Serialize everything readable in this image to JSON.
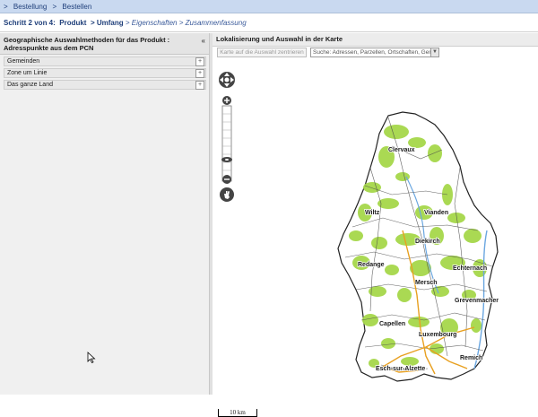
{
  "breadcrumb": {
    "items": [
      ">",
      "Bestellung",
      ">",
      "Bestellen"
    ]
  },
  "steps": {
    "prefix": "Schritt 2 von 4:",
    "step1": "Produkt",
    "sep1": ">",
    "step2": "Umfang",
    "sep2": ">",
    "step3": "Eigenschaften",
    "sep3": ">",
    "step4": "Zusammenfassung"
  },
  "left_panel": {
    "title": "Geographische Auswahlmethoden für das Produkt : Adresspunkte aus dem PCN",
    "collapse_label": "«",
    "items": [
      {
        "label": "Gemeinden",
        "toggle": "+"
      },
      {
        "label": "Zone um Linie",
        "toggle": "+"
      },
      {
        "label": "Das ganze Land",
        "toggle": "+"
      }
    ]
  },
  "map_panel": {
    "title": "Lokalisierung und Auswahl in der Karte",
    "center_button": "Karte auf die Auswahl zentrieren",
    "search_placeholder": "Suche: Adressen, Parzellen, Ortschaften, Gem",
    "scale_label": "10 km",
    "towns": [
      "Clervaux",
      "Wiltz",
      "Vianden",
      "Diekirch",
      "Redange",
      "Echternach",
      "Mersch",
      "Grevenmacher",
      "Capellen",
      "Luxembourg",
      "Remich",
      "Esch-sur-Alzette"
    ],
    "colors": {
      "forest": "#a6d84a",
      "roads_major": "#e8a020",
      "roads_minor": "#4a4a4a",
      "water": "#6aa6e0",
      "border": "#222222"
    }
  }
}
